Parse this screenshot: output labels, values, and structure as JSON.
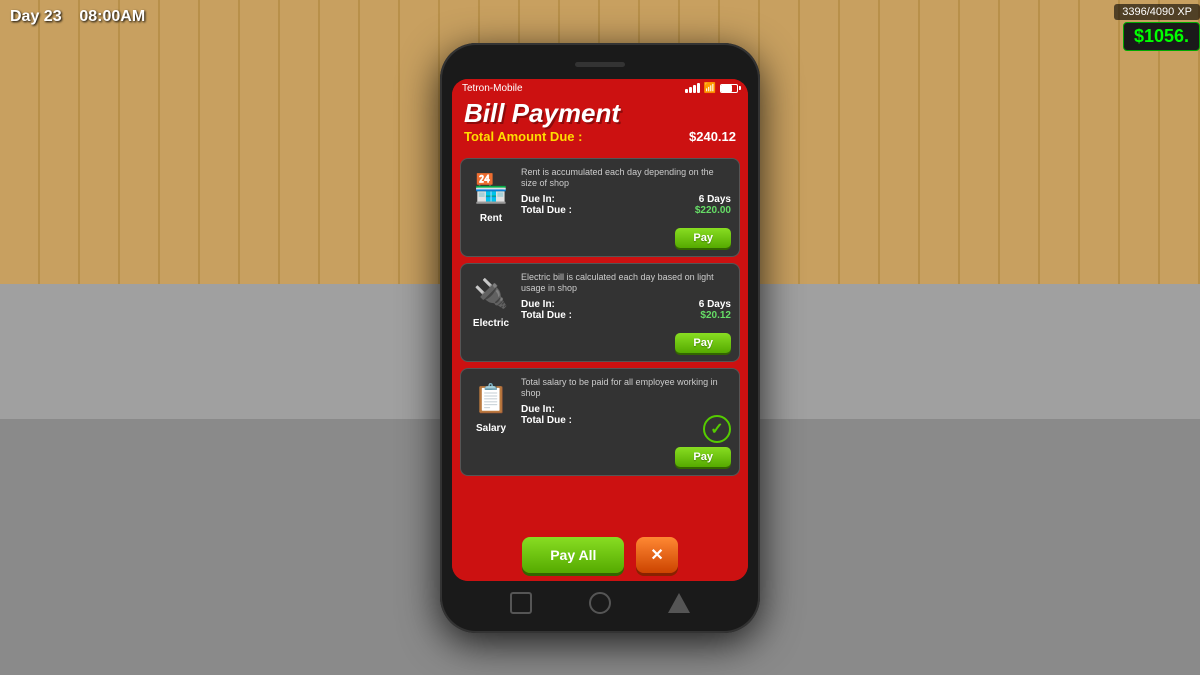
{
  "hud": {
    "day": "Day 23",
    "time": "08:00AM",
    "xp": "3396/4090 XP",
    "money": "$1056."
  },
  "phone": {
    "carrier": "Tetron-Mobile",
    "app_title": "Bill Payment",
    "total_due_label": "Total Amount Due :",
    "total_due_amount": "$240.12",
    "bills": [
      {
        "name": "Rent",
        "description": "Rent is accumulated each day depending on the size of shop",
        "due_in_label": "Due In:",
        "due_in_value": "6 Days",
        "total_due_label": "Total Due :",
        "total_due_value": "$220.00",
        "icon": "🏪",
        "paid": false
      },
      {
        "name": "Electric",
        "description": "Electric bill is calculated each day based on light usage in shop",
        "due_in_label": "Due In:",
        "due_in_value": "6 Days",
        "total_due_label": "Total Due :",
        "total_due_value": "$20.12",
        "icon": "🔋",
        "paid": false
      },
      {
        "name": "Salary",
        "description": "Total salary to be paid for all employee working in shop",
        "due_in_label": "Due In:",
        "due_in_value": "",
        "total_due_label": "Total Due :",
        "total_due_value": "",
        "icon": "📋",
        "paid": true
      }
    ],
    "pay_btn_label": "Pay",
    "pay_all_label": "Pay All",
    "close_label": "✕"
  }
}
